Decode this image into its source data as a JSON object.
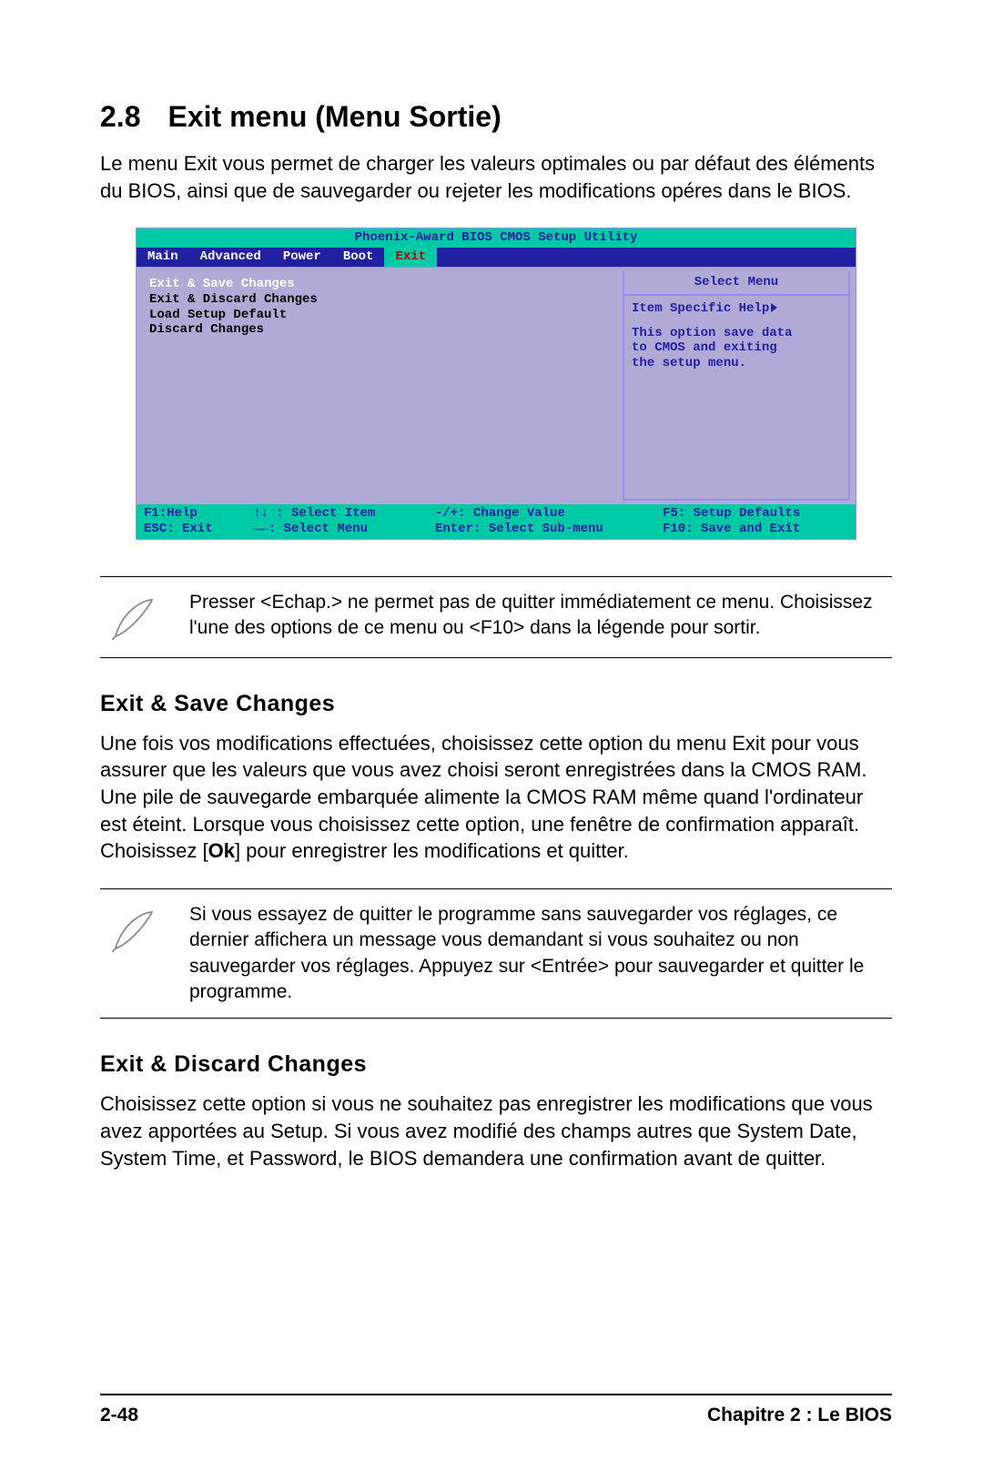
{
  "heading": {
    "number": "2.8",
    "title": "Exit menu (Menu Sortie)"
  },
  "intro": "Le menu Exit vous permet de charger les valeurs optimales ou par défaut des éléments du BIOS, ainsi que de sauvegarder ou rejeter les modifications opéres dans le BIOS.",
  "bios": {
    "title": "Phoenix-Award BIOS CMOS Setup Utility",
    "tabs": {
      "main": "Main",
      "advanced": "Advanced",
      "power": "Power",
      "boot": "Boot",
      "exit": "Exit"
    },
    "items": {
      "i0": "Exit & Save Changes",
      "i1": "Exit & Discard Changes",
      "i2": "Load Setup Default",
      "i3": "Discard Changes"
    },
    "help": {
      "title": "Select Menu",
      "label": "Item Specific Help",
      "l1": "This option save data",
      "l2": "to CMOS and exiting",
      "l3": "the setup menu."
    },
    "footer": {
      "r1c1": "F1:Help",
      "r1c2": "↑↓ : Select Item",
      "r1c3": "-/+: Change Value",
      "r1c4": "F5: Setup Defaults",
      "r2c1": "ESC: Exit",
      "r2c2": "→←: Select Menu",
      "r2c3": "Enter: Select Sub-menu",
      "r2c4": "F10: Save and Exit"
    }
  },
  "note1": "Presser <Echap.> ne permet pas de quitter immédiatement ce menu. Choisissez l'une des options de ce menu ou <F10> dans la légende pour sortir.",
  "sec1_title": "Exit & Save Changes",
  "sec1_body_a": "Une fois vos modifications effectuées, choisissez cette option du menu Exit pour vous assurer que les valeurs que vous avez choisi seront enregistrées dans la CMOS RAM. Une pile de sauvegarde embarquée alimente la CMOS RAM même quand l'ordinateur est éteint. Lorsque vous choisissez cette option, une fenêtre de confirmation apparaît. Choisissez [",
  "sec1_body_ok": "Ok",
  "sec1_body_b": "] pour enregistrer les modifications et quitter.",
  "note2": "Si vous essayez de quitter le programme sans sauvegarder vos réglages, ce dernier affichera un message vous demandant si vous souhaitez ou non sauvegarder vos réglages. Appuyez sur <Entrée> pour sauvegarder et quitter le programme.",
  "sec2_title": "Exit & Discard Changes",
  "sec2_body": "Choisissez cette option si vous ne souhaitez pas enregistrer les modifications que vous avez apportées au Setup. Si vous avez modifié des champs autres que System Date, System Time, et Password, le BIOS demandera une confirmation avant de quitter.",
  "footer": {
    "page": "2-48",
    "chapter": "Chapitre 2 : Le BIOS"
  }
}
